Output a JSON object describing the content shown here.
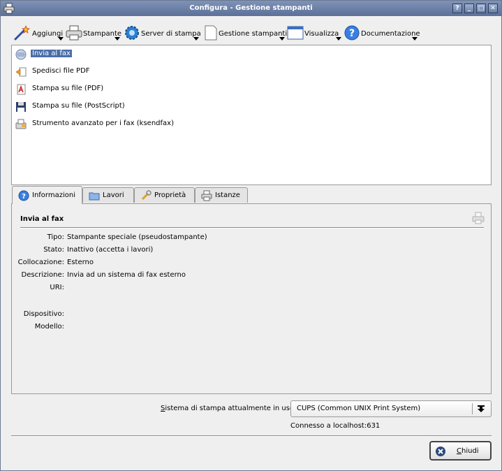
{
  "window": {
    "title": "Configura - Gestione stampanti",
    "buttons": [
      "?",
      "_",
      "□",
      "✕"
    ]
  },
  "toolbar": {
    "items": [
      {
        "label": "Aggiungi",
        "icon": "wand-icon"
      },
      {
        "label": "Stampante",
        "icon": "printer-icon"
      },
      {
        "label": "Server di stampa",
        "icon": "gear-icon"
      },
      {
        "label": "Gestione stampanti",
        "icon": "document-icon"
      },
      {
        "label": "Visualizza",
        "icon": "window-icon"
      },
      {
        "label": "Documentazione",
        "icon": "help-icon"
      }
    ]
  },
  "printers": [
    {
      "label": "Invia al fax",
      "icon": "fax-icon",
      "selected": true
    },
    {
      "label": "Spedisci file PDF",
      "icon": "pdf-mail-icon",
      "selected": false
    },
    {
      "label": "Stampa su file (PDF)",
      "icon": "pdf-icon",
      "selected": false
    },
    {
      "label": "Stampa su file (PostScript)",
      "icon": "floppy-icon",
      "selected": false
    },
    {
      "label": "Strumento avanzato per i fax (ksendfax)",
      "icon": "fax-tool-icon",
      "selected": false
    }
  ],
  "tabs": [
    {
      "label": "Informazioni",
      "icon": "info-icon",
      "active": true
    },
    {
      "label": "Lavori",
      "icon": "folder-icon",
      "active": false
    },
    {
      "label": "Proprietà",
      "icon": "wrench-icon",
      "active": false
    },
    {
      "label": "Istanze",
      "icon": "printer-icon",
      "active": false
    }
  ],
  "info": {
    "title": "Invia al fax",
    "fields": [
      {
        "label": "Tipo:",
        "value": "Stampante speciale (pseudostampante)"
      },
      {
        "label": "Stato:",
        "value": "Inattivo (accetta i lavori)"
      },
      {
        "label": "Collocazione:",
        "value": "Esterno"
      },
      {
        "label": "Descrizione:",
        "value": "Invia ad un sistema di fax esterno"
      },
      {
        "label": "URI:",
        "value": ""
      },
      {
        "label": "Dispositivo:",
        "value": ""
      },
      {
        "label": "Modello:",
        "value": ""
      }
    ]
  },
  "print_system": {
    "label_underlined": "S",
    "label_rest": "istema di stampa attualmente in uso:",
    "selected": "CUPS (Common UNIX Print System)",
    "status": "Connesso a localhost:631"
  },
  "close_button": {
    "underlined": "C",
    "rest": "hiudi"
  }
}
